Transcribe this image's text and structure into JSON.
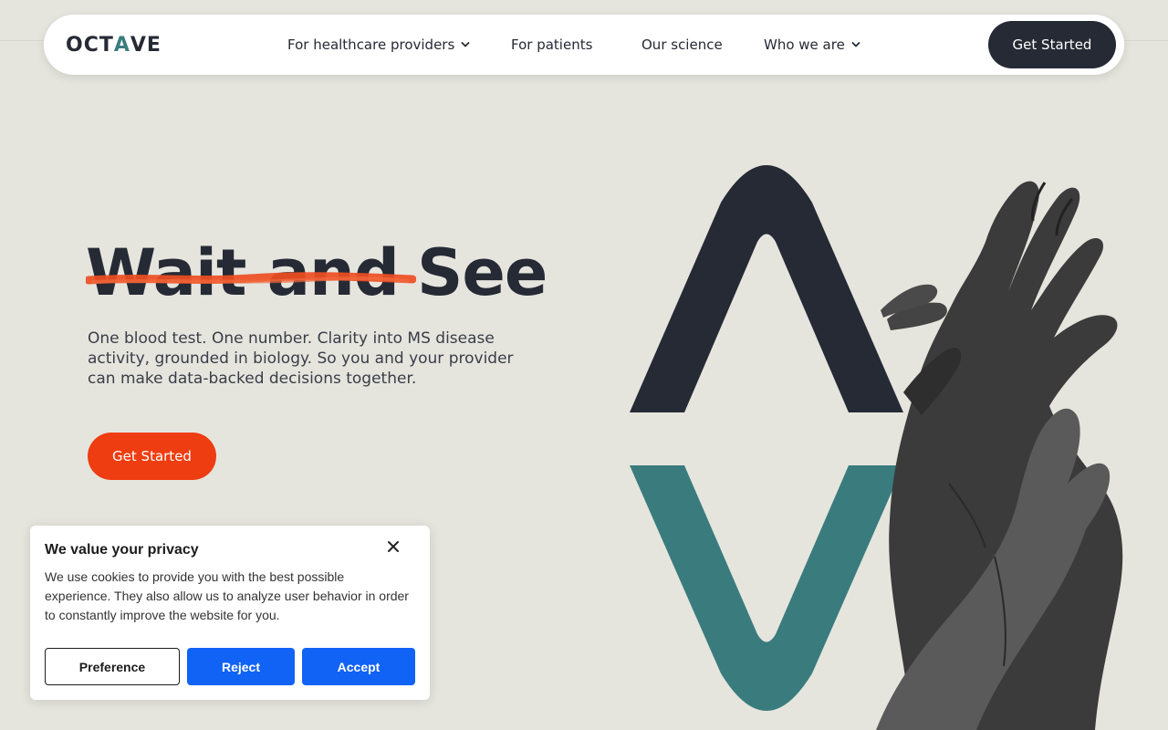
{
  "colors": {
    "background": "#e5e5de",
    "dark": "#262a35",
    "teal": "#3a7c7d",
    "accent": "#ee3d10",
    "cookie_button": "#1163f5"
  },
  "nav": {
    "logo": {
      "part1": "OCT",
      "part2": "A",
      "part3": "VE"
    },
    "links": [
      {
        "label": "For healthcare providers",
        "has_dropdown": true
      },
      {
        "label": "For patients",
        "has_dropdown": false
      },
      {
        "label": "Our science",
        "has_dropdown": false
      },
      {
        "label": "Who we are",
        "has_dropdown": true
      }
    ],
    "cta_label": "Get Started"
  },
  "hero": {
    "headline_struck": "Wait and",
    "headline_rest": "See",
    "subcopy": "One blood test. One number. Clarity into MS disease activity, grounded in biology. So you and your provider can make data-backed decisions together.",
    "cta_label": "Get Started"
  },
  "cookie": {
    "title": "We value your privacy",
    "body": "We use cookies to provide you with the best possible experience. They also allow us to analyze user behavior in order to constantly improve the website for you.",
    "preference_label": "Preference",
    "reject_label": "Reject",
    "accept_label": "Accept"
  }
}
